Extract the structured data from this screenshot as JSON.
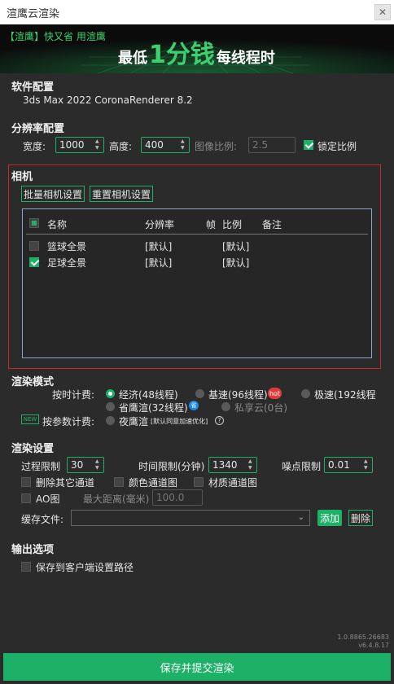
{
  "window": {
    "title": "渲鹰云渲染",
    "close_glyph": "✕"
  },
  "banner": {
    "brand": "【渲鹰】快又省 用渲鹰",
    "headline_prefix": "最低",
    "headline_big": "1分钱",
    "headline_suffix": "每线程时"
  },
  "software": {
    "title": "软件配置",
    "value": "3ds Max 2022   CoronaRenderer 8.2"
  },
  "resolution": {
    "title": "分辨率配置",
    "width_label": "宽度:",
    "width_value": "1000",
    "height_label": "高度:",
    "height_value": "400",
    "ratio_label": "图像比例:",
    "ratio_value": "2.5",
    "lock_label": "锁定比例",
    "lock_checked": true
  },
  "camera": {
    "title": "相机",
    "batch_button": "批量相机设置",
    "reset_button": "重置相机设置",
    "columns": [
      "名称",
      "分辨率",
      "帧",
      "比例",
      "备注"
    ],
    "rows": [
      {
        "name": "篮球全景",
        "resolution": "[默认]",
        "frame": "",
        "ratio": "[默认]",
        "note": "",
        "checked": false
      },
      {
        "name": "足球全景",
        "resolution": "[默认]",
        "frame": "",
        "ratio": "[默认]",
        "note": "",
        "checked": true
      }
    ]
  },
  "render_mode": {
    "title": "渲染模式",
    "time_billing_label": "按时计费:",
    "options": {
      "economy": "经济(48线程)",
      "basic": "基速(96线程)",
      "fast": "极速(192线程",
      "save_eagle": "省鹰渲(32线程)",
      "private_cloud": "私享云(0台)",
      "night_eagle": "夜鹰渲"
    },
    "hot_badge": "hot",
    "blue_badge": "省",
    "new_tag": "NEW",
    "param_billing_label": "按参数计费:",
    "night_note": "[默认同意加速优化]",
    "help_glyph": "?"
  },
  "render_settings": {
    "title": "渲染设置",
    "pass_limit_label": "过程限制",
    "pass_limit_value": "30",
    "time_limit_label": "时间限制(分钟)",
    "time_limit_value": "1340",
    "noise_limit_label": "噪点限制",
    "noise_limit_value": "0.01",
    "delete_other_label": "删除其它通道",
    "color_channel_label": "颜色通道图",
    "material_channel_label": "材质通道图",
    "ao_label": "AO图",
    "max_distance_label": "最大距离(毫米)",
    "max_distance_value": "100.0",
    "cache_label": "缓存文件:",
    "add_button": "添加",
    "delete_button": "删除"
  },
  "output": {
    "title": "输出选项",
    "save_client_label": "保存到客户端设置路径"
  },
  "version": {
    "line1": "1.0.8865.26683",
    "line2": "v6.4.8.17"
  },
  "footer": {
    "submit_button": "保存并提交渲染"
  }
}
